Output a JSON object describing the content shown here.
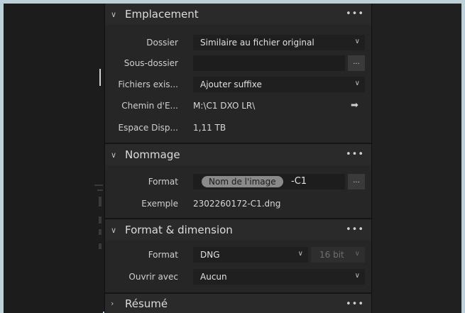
{
  "sections": {
    "emplacement": {
      "title": "Emplacement",
      "menu": "•••",
      "dossier_label": "Dossier",
      "dossier_value": "Similaire au fichier original",
      "sous_dossier_label": "Sous-dossier",
      "sous_dossier_value": "",
      "sous_dossier_button": "...",
      "fichiers_label": "Fichiers exis...",
      "fichiers_value": "Ajouter suffixe",
      "chemin_label": "Chemin d'E...",
      "chemin_value": "M:\\C1 DXO LR\\",
      "espace_label": "Espace Disp...",
      "espace_value": "1,11 TB"
    },
    "nommage": {
      "title": "Nommage",
      "menu": "•••",
      "format_label": "Format",
      "token": "Nom de l'image",
      "suffix": "-C1",
      "format_button": "...",
      "exemple_label": "Exemple",
      "exemple_value": "2302260172-C1.dng"
    },
    "format_dimension": {
      "title": "Format & dimension",
      "menu": "•••",
      "format_label": "Format",
      "format_value": "DNG",
      "bit_value": "16 bit",
      "ouvrir_label": "Ouvrir avec",
      "ouvrir_value": "Aucun"
    },
    "resume": {
      "title": "Résumé",
      "menu": "•••"
    }
  },
  "icons": {
    "chevron_down": "chevron-down-icon",
    "chevron_right": "chevron-right-icon",
    "arrow_right": "arrow-right-icon",
    "more": "more-icon"
  }
}
